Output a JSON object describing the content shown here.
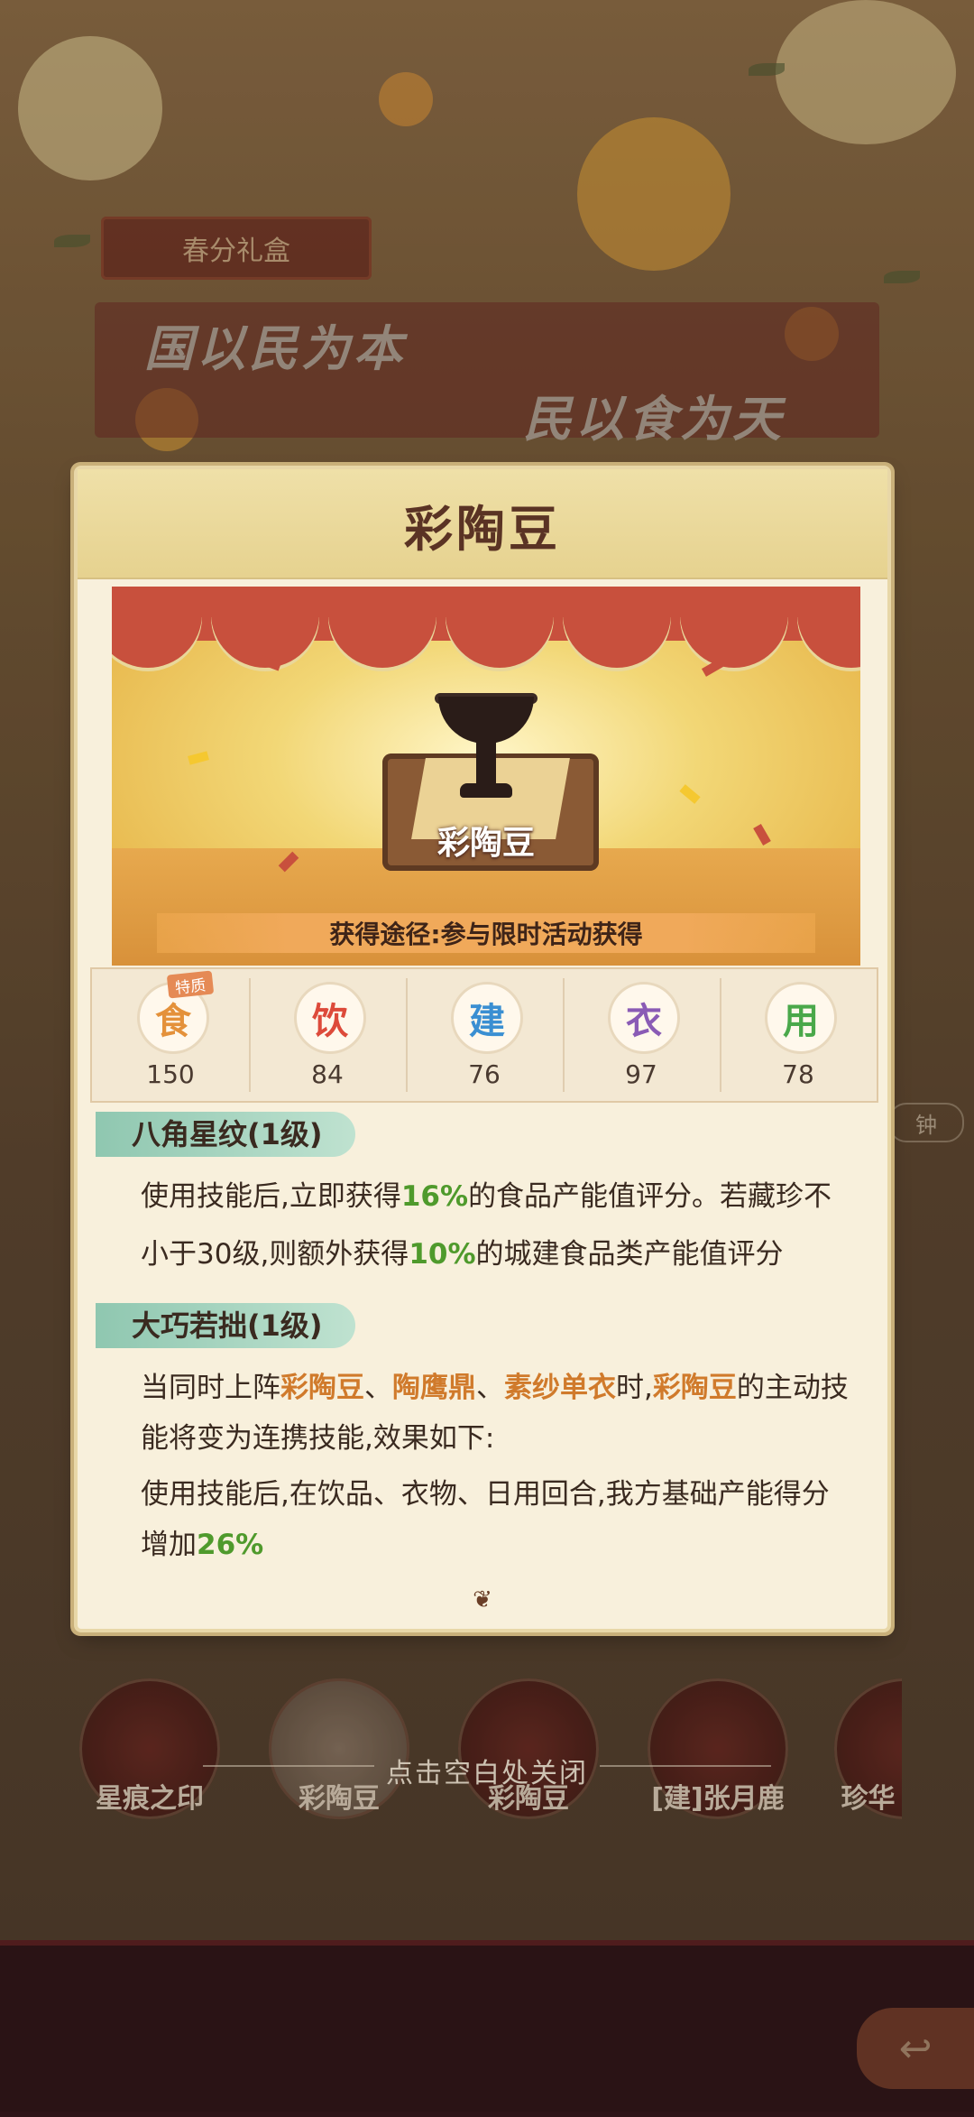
{
  "background": {
    "event_tag": "春分礼盒",
    "slogan_1": "国以民为本",
    "slogan_2": "民以食为天",
    "side_time": "钟",
    "back_icon": "back-arrow-icon"
  },
  "card": {
    "title": "彩陶豆",
    "stage_item_name": "彩陶豆",
    "source": "获得途径:参与限时活动获得",
    "stats": [
      {
        "label": "食",
        "value": "150",
        "color": "#e4913a",
        "badge": "特质"
      },
      {
        "label": "饮",
        "value": "84",
        "color": "#dd4a3a"
      },
      {
        "label": "建",
        "value": "76",
        "color": "#3a8fd2"
      },
      {
        "label": "衣",
        "value": "97",
        "color": "#8a5bb5"
      },
      {
        "label": "用",
        "value": "78",
        "color": "#4aa84a"
      }
    ],
    "skills": [
      {
        "name": "八角星纹(1级)",
        "line1_a": "使用技能后,立即获得",
        "line1_pct": "16%",
        "line1_b": "的食品产能值评分。若藏珍不",
        "line2_a": "小于30级,则额外获得",
        "line2_pct": "10%",
        "line2_b": "的城建食品类产能值评分"
      },
      {
        "name": "大巧若拙(1级)",
        "p1_a": "当同时上阵",
        "p1_item1": "彩陶豆",
        "p1_sep1": "、",
        "p1_item2": "陶鹰鼎",
        "p1_sep2": "、",
        "p1_item3": "素纱单衣",
        "p1_b": "时,",
        "p1_item4": "彩陶豆",
        "p1_c": "的主动技",
        "p2": "能将变为连携技能,效果如下:",
        "p3": "使用技能后,在饮品、衣物、日用回合,我方基础产能得分",
        "p4_a": "增加",
        "p4_pct": "26%"
      }
    ]
  },
  "carousel": {
    "items": [
      {
        "label": "星痕之印",
        "icon": "seal-icon"
      },
      {
        "label": "彩陶豆",
        "icon": "cup-icon",
        "selected": true
      },
      {
        "label": "彩陶豆",
        "icon": "cup-icon"
      },
      {
        "label": "[建]张月鹿",
        "icon": "deer-icon"
      },
      {
        "label": "珍华",
        "icon": "treasure-icon"
      }
    ],
    "close_hint": "点击空白处关闭"
  }
}
